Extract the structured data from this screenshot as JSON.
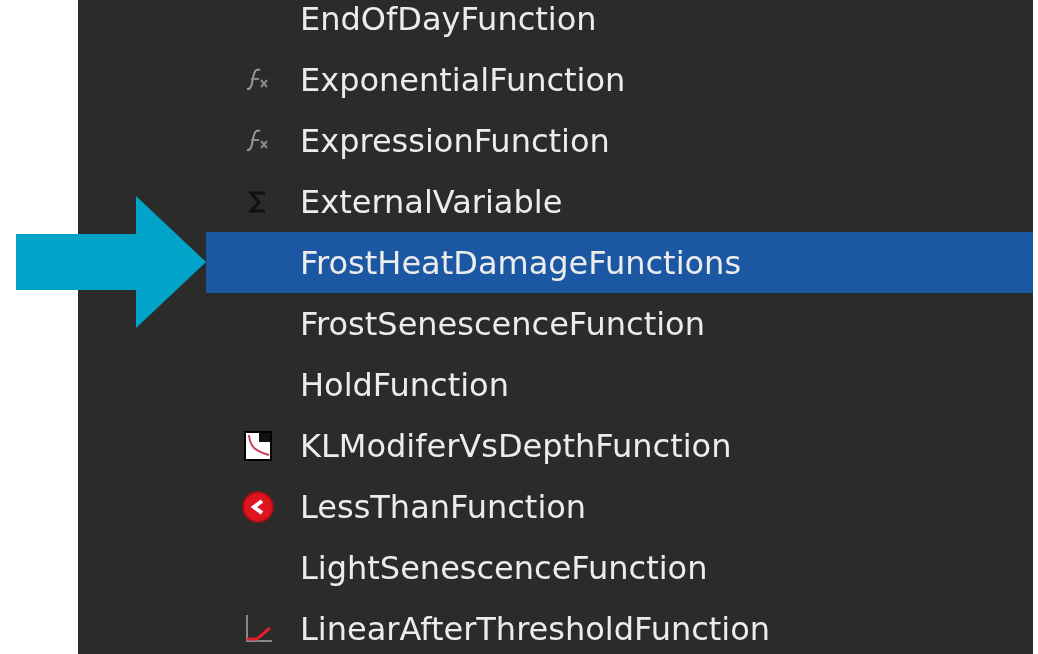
{
  "tree_items": [
    {
      "label": "EndOfDayFunction",
      "kind": "plain",
      "selected": false
    },
    {
      "label": "ExponentialFunction",
      "kind": "function",
      "selected": false
    },
    {
      "label": "ExpressionFunction",
      "kind": "function",
      "selected": false
    },
    {
      "label": "ExternalVariable",
      "kind": "variable",
      "selected": false
    },
    {
      "label": "FrostHeatDamageFunctions",
      "kind": "plain",
      "selected": true
    },
    {
      "label": "FrostSenescenceFunction",
      "kind": "plain",
      "selected": false
    },
    {
      "label": "HoldFunction",
      "kind": "plain",
      "selected": false
    },
    {
      "label": "KLModiferVsDepthFunction",
      "kind": "table",
      "selected": false
    },
    {
      "label": "LessThanFunction",
      "kind": "comparison",
      "selected": false
    },
    {
      "label": "LightSenescenceFunction",
      "kind": "plain",
      "selected": false
    },
    {
      "label": "LinearAfterThresholdFunction",
      "kind": "linear",
      "selected": false
    }
  ]
}
